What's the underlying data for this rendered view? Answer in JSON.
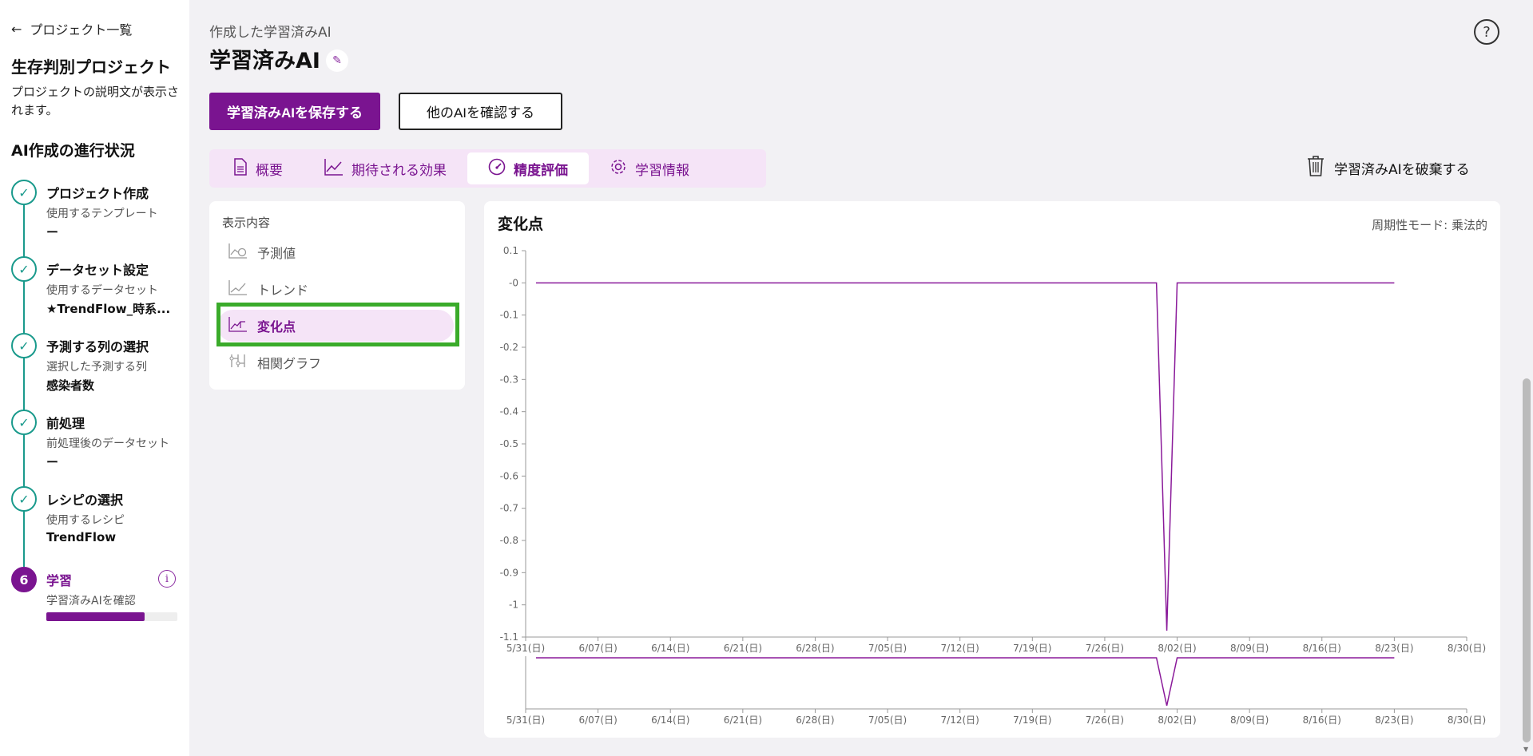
{
  "sidebar": {
    "back_label": "プロジェクト一覧",
    "project_title": "生存判別プロジェクト",
    "project_desc": "プロジェクトの説明文が表示されます。",
    "progress_title": "AI作成の進行状況",
    "steps": [
      {
        "title": "プロジェクト作成",
        "sub": "使用するテンプレート",
        "value": "ー"
      },
      {
        "title": "データセット設定",
        "sub": "使用するデータセット",
        "value": "★TrendFlow_時系..."
      },
      {
        "title": "予測する列の選択",
        "sub": "選択した予測する列",
        "value": "感染者数"
      },
      {
        "title": "前処理",
        "sub": "前処理後のデータセット",
        "value": "ー"
      },
      {
        "title": "レシピの選択",
        "sub": "使用するレシピ",
        "value": "TrendFlow"
      },
      {
        "number": "6",
        "title": "学習",
        "sub": "学習済みAIを確認",
        "progress": 0.75
      }
    ]
  },
  "header": {
    "subtitle": "作成した学習済みAI",
    "title": "学習済みAI",
    "save_button": "学習済みAIを保存する",
    "other_button": "他のAIを確認する"
  },
  "tabs": [
    {
      "label": "概要",
      "icon": "document-icon"
    },
    {
      "label": "期待される効果",
      "icon": "line-chart-icon"
    },
    {
      "label": "精度評価",
      "icon": "gauge-icon",
      "active": true
    },
    {
      "label": "学習情報",
      "icon": "gear-icon"
    }
  ],
  "discard_label": "学習済みAIを破棄する",
  "display_panel": {
    "title": "表示内容",
    "items": [
      {
        "label": "予測値"
      },
      {
        "label": "トレンド"
      },
      {
        "label": "変化点",
        "active": true
      },
      {
        "label": "相関グラフ"
      }
    ]
  },
  "chart_header": {
    "title": "変化点",
    "mode": "周期性モード: 乗法的"
  },
  "chart_data": {
    "type": "line",
    "title": "変化点",
    "x_tick_labels": [
      "5/31(日)",
      "6/07(日)",
      "6/14(日)",
      "6/21(日)",
      "6/28(日)",
      "7/05(日)",
      "7/12(日)",
      "7/19(日)",
      "7/26(日)",
      "8/02(日)",
      "8/09(日)",
      "8/16(日)",
      "8/23(日)",
      "8/30(日)"
    ],
    "y_tick_labels": [
      "0.1",
      "-0",
      "-0.1",
      "-0.2",
      "-0.3",
      "-0.4",
      "-0.5",
      "-0.6",
      "-0.7",
      "-0.8",
      "-0.9",
      "-1",
      "-1.1"
    ],
    "ylim": [
      -1.1,
      0.1
    ],
    "xlim": [
      "2020-05-31",
      "2020-08-30"
    ],
    "series": [
      {
        "color": "#8a1a9a",
        "points": [
          [
            "2020-06-01",
            0
          ],
          [
            "2020-07-31",
            0
          ],
          [
            "2020-08-01",
            -1.08
          ],
          [
            "2020-08-02",
            0
          ],
          [
            "2020-08-23",
            0
          ]
        ]
      }
    ],
    "brush": {
      "points": [
        [
          "2020-06-01",
          0
        ],
        [
          "2020-07-31",
          0
        ],
        [
          "2020-08-01",
          -1.08
        ],
        [
          "2020-08-02",
          0
        ],
        [
          "2020-08-23",
          0
        ]
      ]
    }
  }
}
